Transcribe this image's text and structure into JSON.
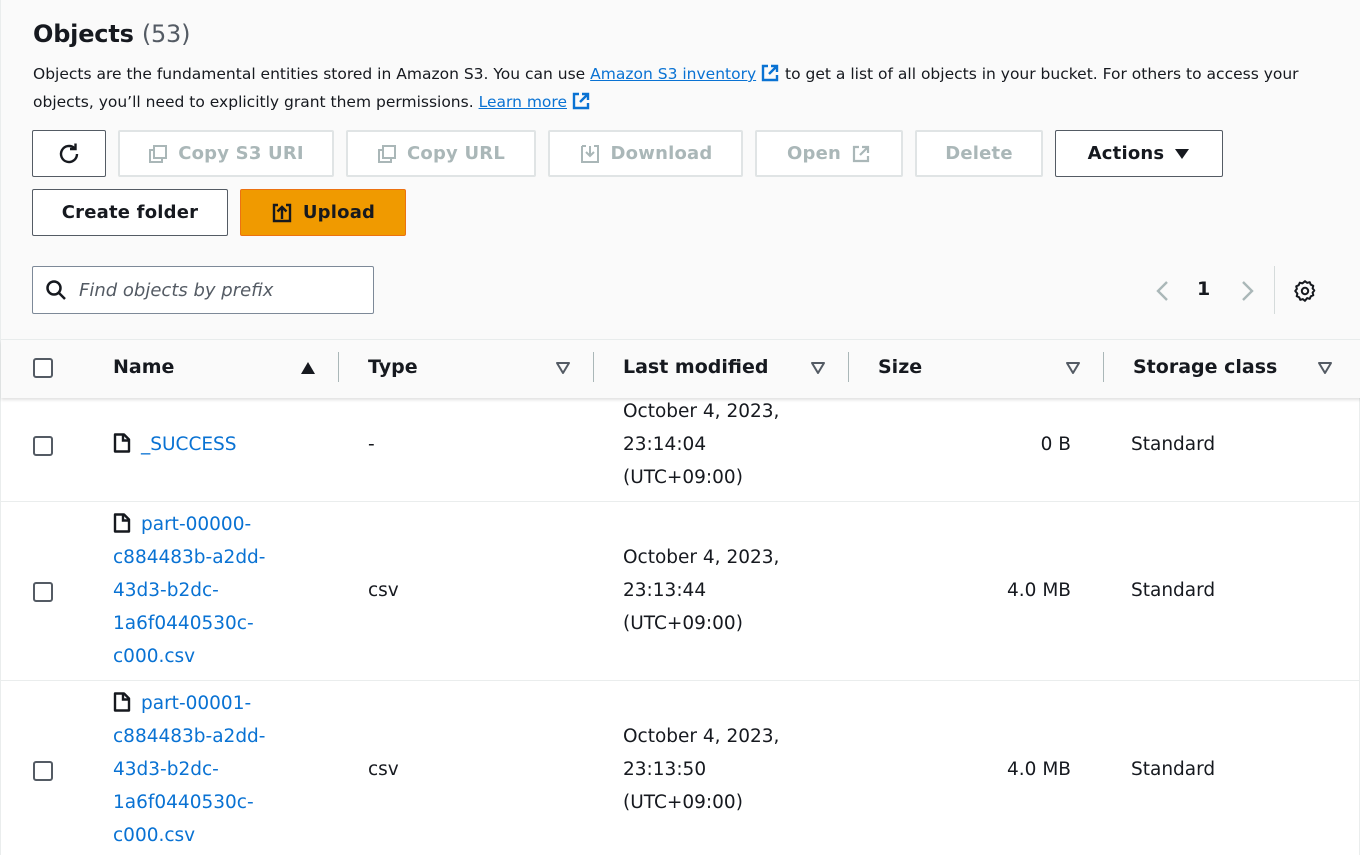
{
  "header": {
    "title": "Objects",
    "count": "(53)",
    "desc_part1": "Objects are the fundamental entities stored in Amazon S3. You can use ",
    "inventory_link": "Amazon S3 inventory",
    "desc_part2": " to get a list of all objects in your bucket. For others to access your objects, you’ll need to explicitly grant them permissions. ",
    "learn_more": "Learn more"
  },
  "toolbar": {
    "copy_s3_uri": "Copy S3 URI",
    "copy_url": "Copy URL",
    "download": "Download",
    "open": "Open",
    "delete": "Delete",
    "actions": "Actions",
    "create_folder": "Create folder",
    "upload": "Upload"
  },
  "search": {
    "placeholder": "Find objects by prefix"
  },
  "pagination": {
    "current_page": "1"
  },
  "table": {
    "columns": {
      "name": "Name",
      "type": "Type",
      "last_modified": "Last modified",
      "size": "Size",
      "storage_class": "Storage class"
    },
    "rows": [
      {
        "name_lines": [
          "_SUCCESS"
        ],
        "type": "-",
        "modified_lines": [
          "October 4, 2023,",
          "23:14:04",
          "(UTC+09:00)"
        ],
        "size": "0 B",
        "storage_class": "Standard"
      },
      {
        "name_lines": [
          "part-00000-",
          "c884483b-a2dd-",
          "43d3-b2dc-",
          "1a6f0440530c-",
          "c000.csv"
        ],
        "type": "csv",
        "modified_lines": [
          "October 4, 2023,",
          "23:13:44",
          "(UTC+09:00)"
        ],
        "size": "4.0 MB",
        "storage_class": "Standard"
      },
      {
        "name_lines": [
          "part-00001-",
          "c884483b-a2dd-",
          "43d3-b2dc-",
          "1a6f0440530c-",
          "c000.csv"
        ],
        "type": "csv",
        "modified_lines": [
          "October 4, 2023,",
          "23:13:50",
          "(UTC+09:00)"
        ],
        "size": "4.0 MB",
        "storage_class": "Standard"
      }
    ]
  },
  "colors": {
    "link": "#0972d3",
    "primary": "#f09a00",
    "disabled": "#aab7b8",
    "text": "#16191f"
  },
  "icons": [
    "refresh-icon",
    "copy-icon",
    "download-icon",
    "external-link-icon",
    "caret-down-icon",
    "upload-icon",
    "search-icon",
    "chevron-left-icon",
    "chevron-right-icon",
    "settings-icon",
    "sort-asc-icon",
    "sort-desc-icon",
    "file-icon"
  ]
}
